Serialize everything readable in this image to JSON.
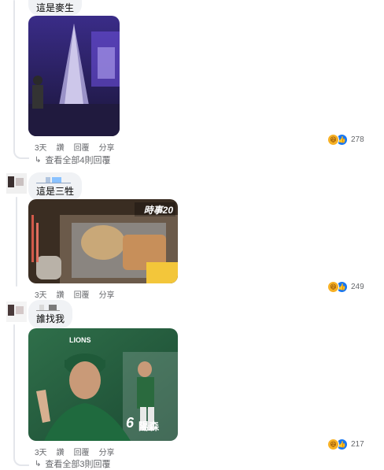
{
  "colors": {
    "line": "#e4e6eb",
    "bubble": "#f0f2f5",
    "muted": "#65676b",
    "like_blue": "#1877f2",
    "haha_yellow": "#f7b125"
  },
  "comments": [
    {
      "text": "這是麥生",
      "actions": [
        "3天",
        "讚",
        "回覆",
        "分享"
      ],
      "reaction_count": "278",
      "more_replies": "查看全部4則回覆"
    },
    {
      "text": "這是三牲",
      "photo_badge": "時事20",
      "actions": [
        "3天",
        "讚",
        "回覆",
        "分享"
      ],
      "reaction_count": "249"
    },
    {
      "text": "誰找我",
      "photo_badge": "LIONS",
      "photo_caption_number": "6",
      "photo_caption_name": "陽森",
      "actions": [
        "3天",
        "讚",
        "回覆",
        "分享"
      ],
      "reaction_count": "217",
      "more_replies": "查看全部3則回覆"
    }
  ],
  "icons": {
    "haha": "haha-reaction-icon",
    "like": "like-reaction-icon",
    "reply_arrow": "reply-arrow-icon"
  }
}
